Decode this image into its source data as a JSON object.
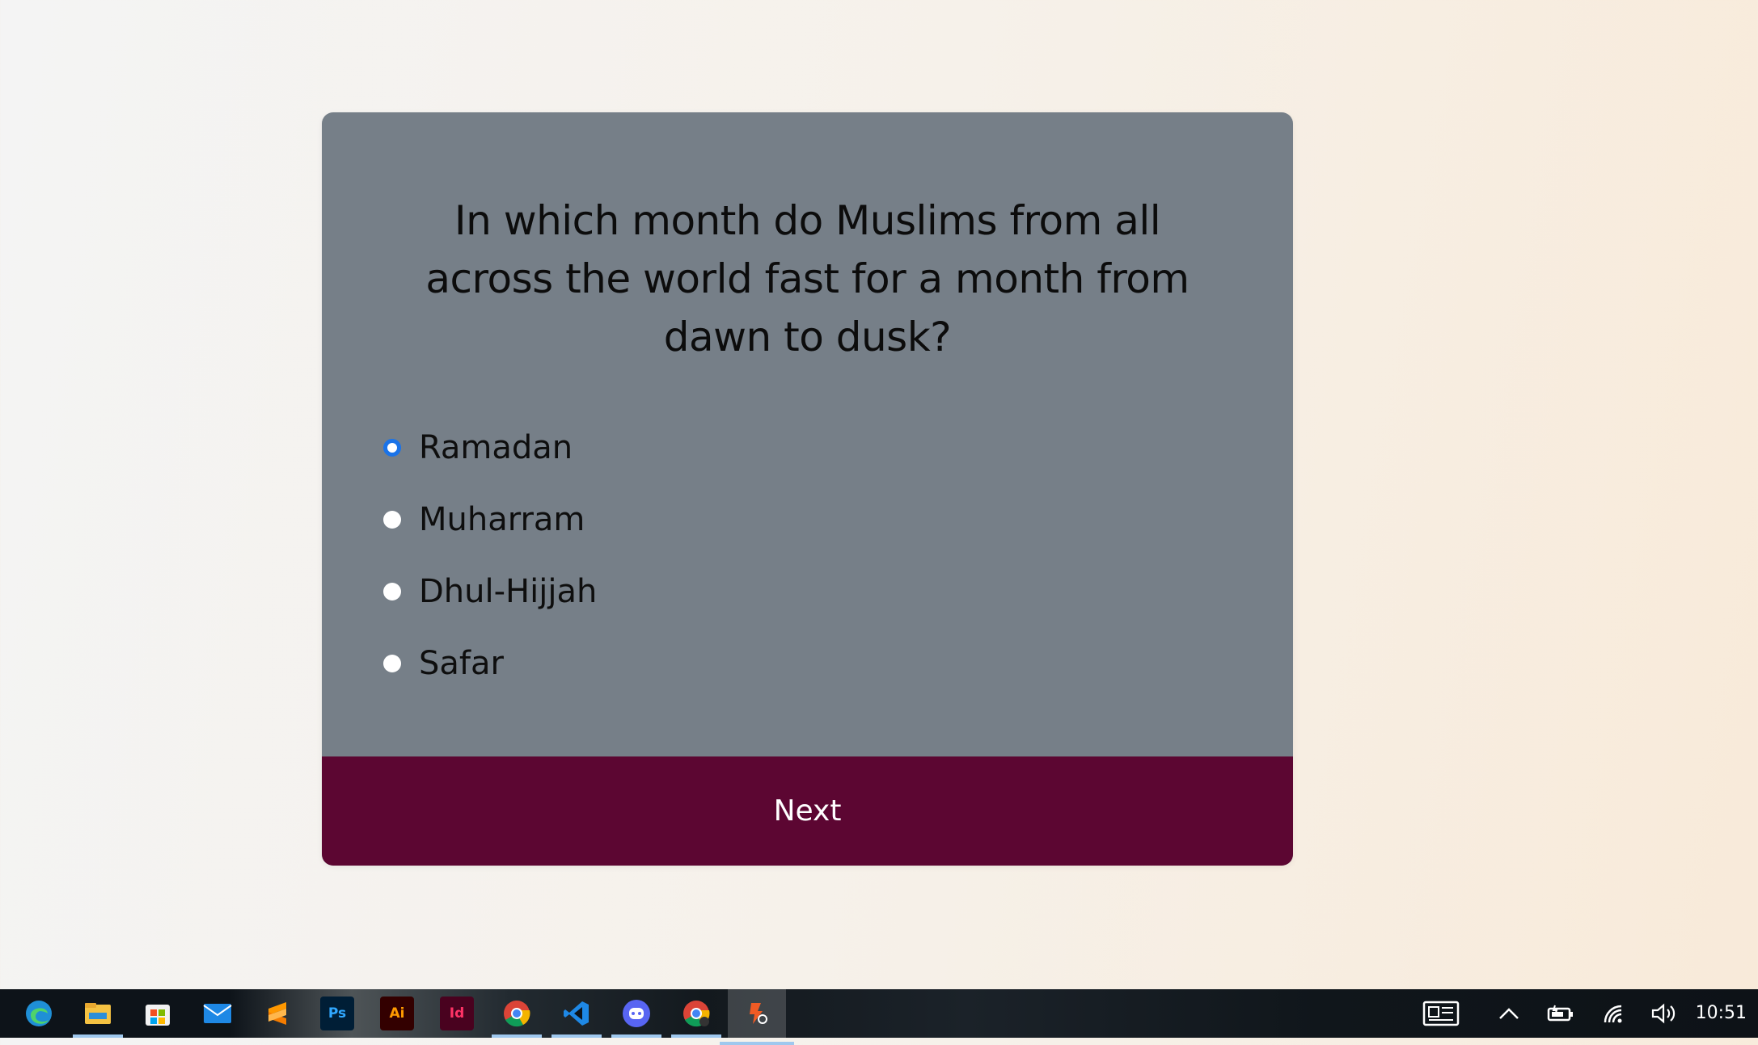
{
  "quiz": {
    "question": "In which month do Muslims from all across the world fast for a month from dawn to dusk?",
    "options": [
      {
        "label": "Ramadan",
        "selected": true
      },
      {
        "label": "Muharram",
        "selected": false
      },
      {
        "label": "Dhul-Hijjah",
        "selected": false
      },
      {
        "label": "Safar",
        "selected": false
      }
    ],
    "next_label": "Next"
  },
  "colors": {
    "card": "#767f88",
    "next_button": "#5c0632",
    "radio_selected": "#1a73e8"
  },
  "taskbar": {
    "apps": [
      "edge-icon",
      "file-explorer-icon",
      "microsoft-store-icon",
      "mail-icon",
      "sublime-text-icon",
      "photoshop-icon",
      "illustrator-icon",
      "indesign-icon",
      "chrome-icon",
      "vscode-icon",
      "discord-icon",
      "chrome-profile-icon",
      "postman-icon"
    ],
    "app_text": {
      "photoshop": "Ps",
      "illustrator": "Ai",
      "indesign": "Id"
    },
    "tray_icons": [
      "news-icon",
      "chevron-up-icon",
      "battery-icon",
      "wifi-icon",
      "volume-icon"
    ],
    "time": "10:51"
  }
}
